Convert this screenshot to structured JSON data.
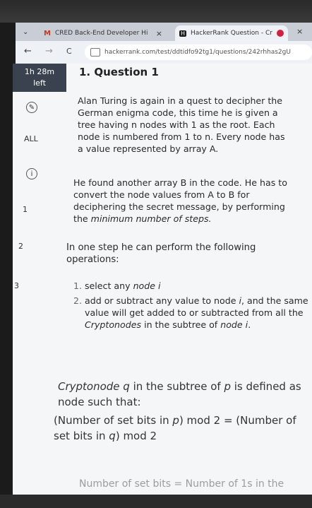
{
  "browser": {
    "tabs": [
      {
        "logo": "M",
        "label": "CRED Back-End Developer Hi",
        "close": "×",
        "active": false
      },
      {
        "logo": "H",
        "label": "HackerRank Question - Cr",
        "close": "×",
        "active": true
      }
    ],
    "end_close": "×",
    "nav": {
      "back": "←",
      "forward": "→",
      "reload": "C"
    },
    "url": "hackerrank.com/test/ddtidfo92tg1/questions/242rhhas2gU"
  },
  "sidebar": {
    "timer_line1": "1h 28m",
    "timer_line2": "left",
    "all_label": "ALL",
    "info_icon": "i",
    "question_numbers": [
      "1",
      "2",
      "3"
    ]
  },
  "question": {
    "title": "1. Question 1",
    "intro": "Alan Turing is again in a quest to decipher the German enigma code, this time he is given a tree having n nodes with 1 as the root. Each node is numbered from 1 to n. Every node has a value represented by array A.",
    "second_pre": "He found another array B in the code. He has to convert the node values from A to B for deciphering the secret message, by performing the ",
    "second_em": "minimum number of steps.",
    "ops_intro": "In one step he can perform the following operations:",
    "ops": [
      {
        "num": "1.",
        "pre": "select any ",
        "em": "node i",
        "post": ""
      },
      {
        "num": "2.",
        "pre": "add or subtract any value to node ",
        "em": "i",
        "mid": ", and the same value will get added to or subtracted from all the ",
        "em2": "Cryptonodes",
        "post2": " in the subtree of ",
        "em3": "node i",
        "post3": "."
      }
    ],
    "crypto_def": {
      "em1": "Cryptonode q",
      "t1": " in the subtree of ",
      "em2": "p",
      "t2": " is defined as node such that:"
    },
    "formula": {
      "t1": "(Number of set bits in ",
      "em1": "p",
      "t2": ") mod 2 = (Number of set bits in ",
      "em2": "q",
      "t3": ") mod 2"
    },
    "cutoff": "Number of set bits = Number of 1s in the"
  }
}
